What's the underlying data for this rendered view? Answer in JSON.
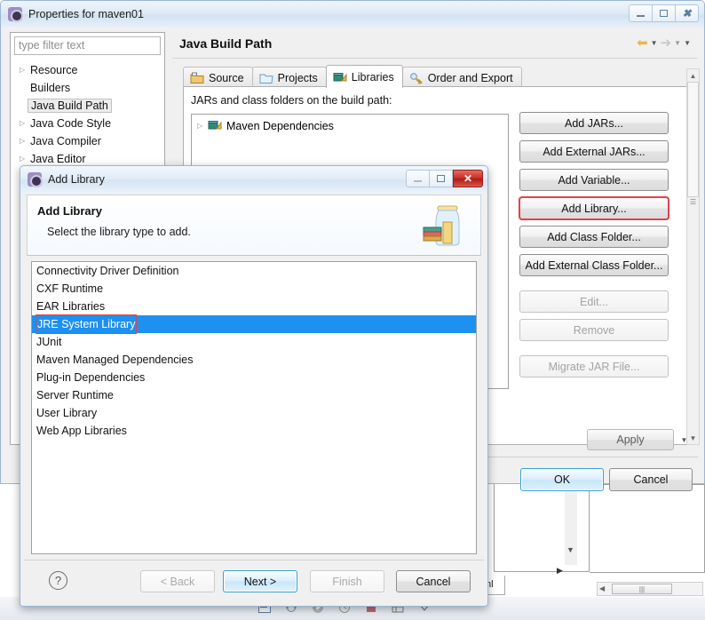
{
  "properties_window": {
    "title": "Properties for maven01",
    "icon": "eclipse-icon",
    "window_buttons": {
      "minimize": "minimize-icon",
      "maximize": "maximize-icon",
      "close": "close-icon"
    },
    "filter": {
      "placeholder": "type filter text",
      "value": ""
    },
    "tree_items": [
      {
        "label": "Resource",
        "expandable": true,
        "selected": false
      },
      {
        "label": "Builders",
        "expandable": false,
        "selected": false
      },
      {
        "label": "Java Build Path",
        "expandable": false,
        "selected": true
      },
      {
        "label": "Java Code Style",
        "expandable": true,
        "selected": false
      },
      {
        "label": "Java Compiler",
        "expandable": true,
        "selected": false
      },
      {
        "label": "Java Editor",
        "expandable": true,
        "selected": false
      }
    ],
    "page_title": "Java Build Path",
    "nav": {
      "back": "back-arrow-icon",
      "forward": "forward-arrow-icon",
      "menu": "dropdown-arrow-icon"
    },
    "tabs": [
      {
        "label": "Source",
        "icon": "source-folder-icon",
        "active": false
      },
      {
        "label": "Projects",
        "icon": "projects-folder-icon",
        "active": false
      },
      {
        "label": "Libraries",
        "icon": "libraries-icon",
        "active": true
      },
      {
        "label": "Order and Export",
        "icon": "order-export-icon",
        "active": false
      }
    ],
    "jars_label": "JARs and class folders on the build path:",
    "jars_tree": [
      {
        "label": "Maven Dependencies",
        "icon": "library-icon",
        "expandable": true
      }
    ],
    "action_buttons": [
      {
        "label": "Add JARs...",
        "enabled": true,
        "highlighted": false
      },
      {
        "label": "Add External JARs...",
        "enabled": true,
        "highlighted": false
      },
      {
        "label": "Add Variable...",
        "enabled": true,
        "highlighted": false
      },
      {
        "label": "Add Library...",
        "enabled": true,
        "highlighted": true
      },
      {
        "label": "Add Class Folder...",
        "enabled": true,
        "highlighted": false
      },
      {
        "label": "Add External Class Folder...",
        "enabled": true,
        "highlighted": false
      },
      {
        "label": "Edit...",
        "enabled": false,
        "highlighted": false
      },
      {
        "label": "Remove",
        "enabled": false,
        "highlighted": false
      },
      {
        "label": "Migrate JAR File...",
        "enabled": false,
        "highlighted": false
      }
    ],
    "apply_label": "Apply",
    "ok_label": "OK",
    "cancel_label": "Cancel"
  },
  "add_library_dialog": {
    "title": "Add Library",
    "icon": "eclipse-icon",
    "close_label": "✕",
    "heading": "Add Library",
    "subheading": "Select the library type to add.",
    "banner_icon": "jar-with-books-icon",
    "library_types": [
      {
        "label": "Connectivity Driver Definition",
        "selected": false
      },
      {
        "label": "CXF Runtime",
        "selected": false
      },
      {
        "label": "EAR Libraries",
        "selected": false
      },
      {
        "label": "JRE System Library",
        "selected": true
      },
      {
        "label": "JUnit",
        "selected": false
      },
      {
        "label": "Maven Managed Dependencies",
        "selected": false
      },
      {
        "label": "Plug-in Dependencies",
        "selected": false
      },
      {
        "label": "Server Runtime",
        "selected": false
      },
      {
        "label": "User Library",
        "selected": false
      },
      {
        "label": "Web App Libraries",
        "selected": false
      }
    ],
    "help_icon": "?",
    "buttons": {
      "back": {
        "label": "< Back",
        "enabled": false
      },
      "next": {
        "label": "Next >",
        "enabled": true,
        "primary": true
      },
      "finish": {
        "label": "Finish",
        "enabled": false
      },
      "cancel": {
        "label": "Cancel",
        "enabled": true
      }
    }
  },
  "background": {
    "editor_tab_label": "ml",
    "taskbar_icons": [
      "console-icon",
      "debug-icon",
      "run-icon",
      "history-icon",
      "stop-icon",
      "outline-icon",
      "collapse-icon"
    ]
  },
  "colors": {
    "selection_blue": "#1e90f0",
    "highlight_red": "#e0434a",
    "title_bar": "#dfeaf6",
    "primary_button": "#c9e6fa"
  }
}
